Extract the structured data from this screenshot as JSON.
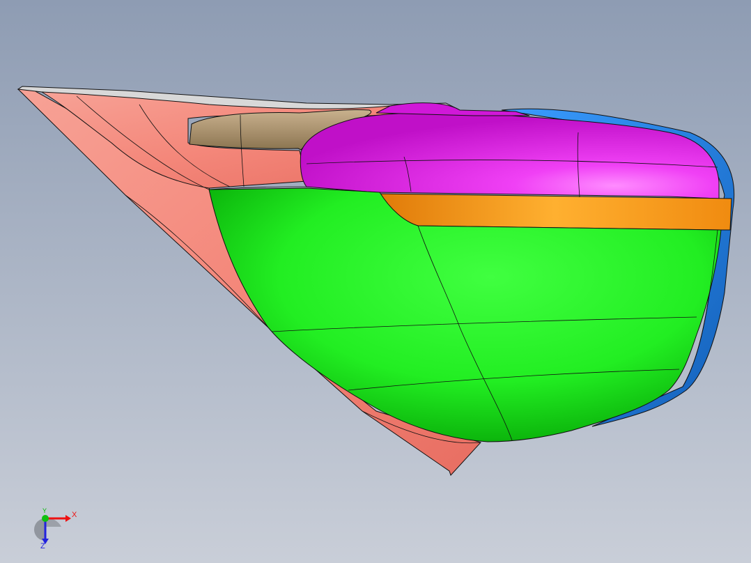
{
  "viewport": {
    "background_top": "#8e9cb3",
    "background_bottom": "#c9ced8"
  },
  "model": {
    "faces": [
      {
        "name": "salmon-housing",
        "color": "#f4877a"
      },
      {
        "name": "tan-cover",
        "color": "#a58d6a"
      },
      {
        "name": "magenta-cap",
        "color": "#e010e8"
      },
      {
        "name": "orange-strip",
        "color": "#f08b10"
      },
      {
        "name": "green-shell",
        "color": "#22ee22"
      },
      {
        "name": "blue-rim",
        "color": "#1d7de0"
      }
    ],
    "edge_color": "#111111"
  },
  "triad": {
    "x_label": "X",
    "y_label": "Y",
    "z_label": "Z",
    "x_color": "#ee1111",
    "y_color": "#10c010",
    "z_color": "#2222dd"
  }
}
